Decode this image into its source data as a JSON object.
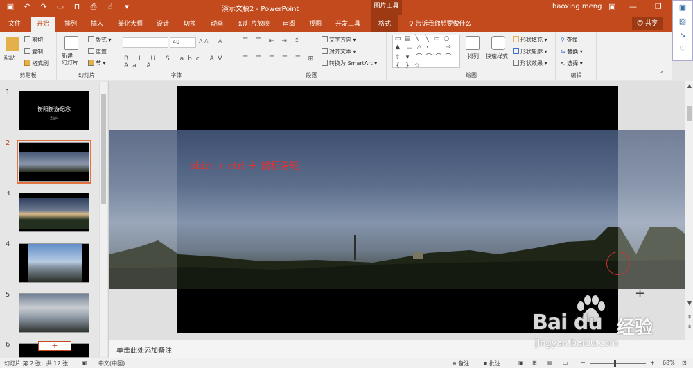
{
  "app": {
    "doc_title": "演示文稿2 - PowerPoint",
    "contextual_tools": "图片工具",
    "user": "baoxing meng"
  },
  "tabs": [
    "文件",
    "开始",
    "排列",
    "插入",
    "美化大师",
    "设计",
    "切换",
    "动画",
    "幻灯片放映",
    "审阅",
    "视图",
    "开发工具",
    "格式"
  ],
  "active_tab": "开始",
  "tell_me": "告诉我你想要做什么",
  "share": "共享",
  "ribbon": {
    "clipboard": {
      "label": "剪贴板",
      "paste": "粘贴",
      "cut": "剪切",
      "copy": "复制",
      "format_painter": "格式刷"
    },
    "slides": {
      "label": "幻灯片",
      "new_slide": "新建\n幻灯片",
      "layout": "版式",
      "reset": "重置",
      "section": "节"
    },
    "font": {
      "label": "字体",
      "font_name": "",
      "font_size": "40"
    },
    "paragraph": {
      "label": "段落",
      "text_direction": "文字方向",
      "align_text": "对齐文本",
      "smartart": "转换为 SmartArt"
    },
    "drawing": {
      "label": "绘图",
      "arrange": "排列",
      "quick_styles": "快速样式",
      "shape_fill": "形状填充",
      "shape_outline": "形状轮廓",
      "shape_effects": "形状效果"
    },
    "editing": {
      "label": "编辑",
      "find": "查找",
      "replace": "替换",
      "select": "选择"
    }
  },
  "thumbnails": [
    {
      "num": "1",
      "title": "衡阳衡游纪念",
      "subtitle": "孟宝兴"
    },
    {
      "num": "2"
    },
    {
      "num": "3"
    },
    {
      "num": "4"
    },
    {
      "num": "5"
    },
    {
      "num": "6"
    }
  ],
  "selected_slide": 2,
  "slide_text": "shirt + ctrl ＋ 鼠标滑轮",
  "notes_placeholder": "单击此处添加备注",
  "status": {
    "slide_info": "幻灯片 第 2 张，共 12 张",
    "language": "中文(中国)",
    "notes_btn": "备注",
    "comments_btn": "批注",
    "zoom": "68%"
  },
  "watermark": {
    "brand": "Bai du",
    "sub": "经验",
    "url": "jingyan.baidu.com"
  },
  "colors": {
    "accent": "#c24a1c",
    "text_red": "#e83030"
  }
}
